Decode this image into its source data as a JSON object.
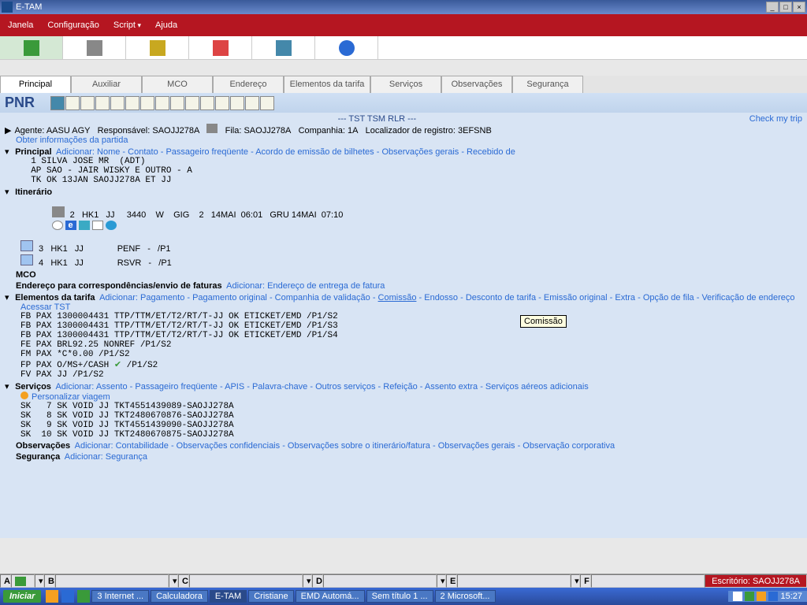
{
  "window": {
    "title": "E-TAM"
  },
  "menu": {
    "janela": "Janela",
    "config": "Configuração",
    "script": "Script",
    "ajuda": "Ajuda"
  },
  "tabs": [
    "Principal",
    "Auxiliar",
    "MCO",
    "Endereço",
    "Elementos da tarifa",
    "Serviços",
    "Observações",
    "Segurança"
  ],
  "pnr_label": "PNR",
  "tst_header": "--- TST TSM RLR ---",
  "check_trip": "Check my trip",
  "agent": {
    "label_agent": "Agente:",
    "agent": "AASU  AGY",
    "label_resp": "Responsável:",
    "resp": "SAOJJ278A",
    "label_fila": "Fila:",
    "fila": "SAOJJ278A",
    "label_comp": "Companhia:",
    "comp": "1A",
    "label_loc": "Localizador de registro:",
    "loc": "3EFSNB"
  },
  "obter": "Obter informações da partida",
  "principal": {
    "hd": "Principal",
    "add": "Adicionar:",
    "links": [
      "Nome",
      "Contato",
      "Passageiro freqüente",
      "Acordo de emissão de bilhetes",
      "Observações gerais",
      "Recebido de"
    ],
    "lines": [
      "  1 SILVA JOSE MR  (ADT)",
      "  AP SAO - JAIR WISKY E OUTRO - A",
      "  TK OK 13JAN SAOJJ278A ET JJ"
    ]
  },
  "itin": {
    "hd": "Itinerário",
    "seg2": " 2   HK1   JJ     3440    W    GIG    2   14MAI  06:01   GRU 14MAI  07:10 ",
    "seg3": " 3   HK1   JJ              PENF   -   /P1",
    "seg4": " 4   HK1   JJ              RSVR   -   /P1"
  },
  "mco_hd": "MCO",
  "endereco": {
    "hd": "Endereço para correspondências/envio de faturas",
    "add": "Adicionar:",
    "link": "Endereço de entrega de fatura"
  },
  "fare": {
    "hd": "Elementos da tarifa",
    "add": "Adicionar:",
    "links": [
      "Pagamento",
      "Pagamento original",
      "Companhia de validação",
      "Comissão",
      "Endosso",
      "Desconto de tarifa",
      "Emissão original",
      "Extra",
      "Opção de fila",
      "Verificação de endereço"
    ],
    "tooltip": "Comissão",
    "tst": "Acessar TST",
    "lines": [
      "FB PAX 1300004431 TTP/TTM/ET/T2/RT/T-JJ OK ETICKET/EMD /P1/S2",
      "FB PAX 1300004431 TTP/TTM/ET/T2/RT/T-JJ OK ETICKET/EMD /P1/S3",
      "FB PAX 1300004431 TTP/TTM/ET/T2/RT/T-JJ OK ETICKET/EMD /P1/S4",
      "FE PAX BRL92.25 NONREF /P1/S2",
      "FM PAX *C*0.00 /P1/S2",
      "FP PAX O/MS+/CASH ✔ /P1/S2",
      "FV PAX JJ /P1/S2"
    ]
  },
  "serv": {
    "hd": "Serviços",
    "add": "Adicionar:",
    "links": [
      "Assento",
      "Passageiro freqüente",
      "APIS",
      "Palavra-chave",
      "Outros serviços",
      "Refeição",
      "Assento extra",
      "Serviços aéreos adicionais"
    ],
    "pers": "Personalizar viagem",
    "lines": [
      "SK   7 SK VOID JJ TKT4551439089-SAOJJ278A",
      "SK   8 SK VOID JJ TKT2480670876-SAOJJ278A",
      "SK   9 SK VOID JJ TKT4551439090-SAOJJ278A",
      "SK  10 SK VOID JJ TKT2480670875-SAOJJ278A"
    ]
  },
  "obs": {
    "hd": "Observações",
    "add": "Adicionar:",
    "links": [
      "Contabilidade",
      "Observações confidenciais",
      "Observações sobre o itinerário/fatura",
      "Observações gerais",
      "Observação corporativa"
    ]
  },
  "seg": {
    "hd": "Segurança",
    "add": "Adicionar:",
    "link": "Segurança"
  },
  "status": {
    "A": "A",
    "B": "B",
    "C": "C",
    "D": "D",
    "E": "E",
    "F": "F",
    "office_lbl": "Escritório:",
    "office": "SAOJJ278A"
  },
  "taskbar": {
    "start": "Iniciar",
    "items": [
      "3 Internet ...",
      "Calculadora",
      "E-TAM",
      "Cristiane",
      "EMD Automá...",
      "Sem título 1 ...",
      "2 Microsoft..."
    ],
    "time": "15:27"
  }
}
